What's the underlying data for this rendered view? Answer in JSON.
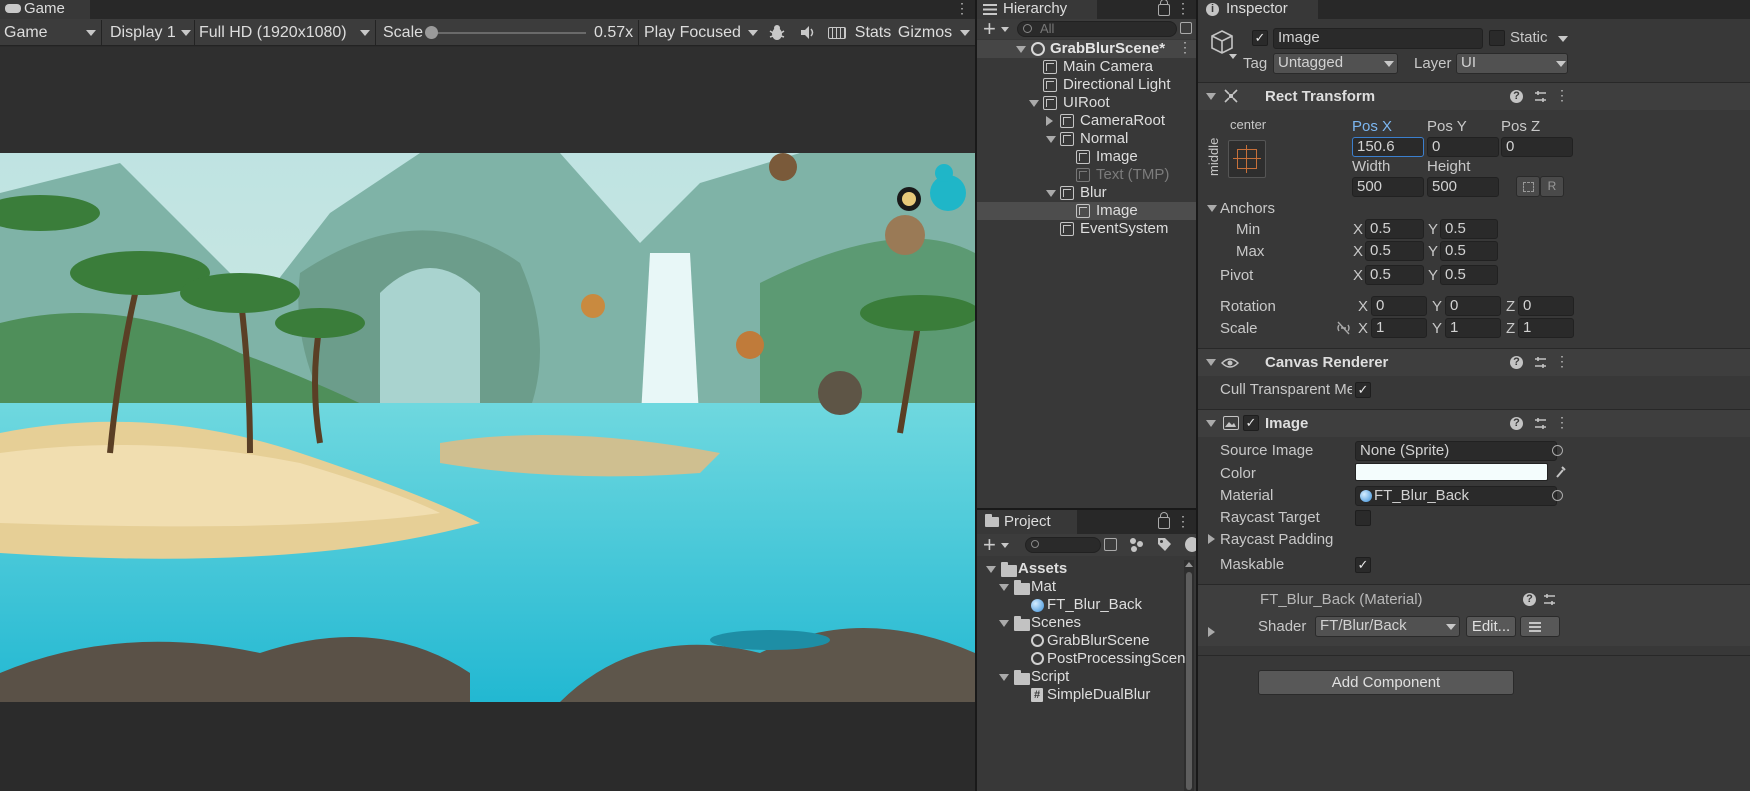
{
  "game": {
    "tab_label": "Game",
    "toolbar": {
      "mode": "Game",
      "display": "Display 1",
      "resolution": "Full HD (1920x1080)",
      "scale_label": "Scale",
      "scale_value": "0.57x",
      "play_mode": "Play Focused",
      "stats": "Stats",
      "gizmos": "Gizmos"
    }
  },
  "hierarchy": {
    "tab_label": "Hierarchy",
    "search_placeholder": "All",
    "scene_name": "GrabBlurScene*",
    "items": [
      {
        "label": "Main Camera",
        "depth": 1,
        "expand": "none",
        "dim": false,
        "selected": false
      },
      {
        "label": "Directional Light",
        "depth": 1,
        "expand": "none",
        "dim": false,
        "selected": false
      },
      {
        "label": "UIRoot",
        "depth": 1,
        "expand": "open",
        "dim": false,
        "selected": false
      },
      {
        "label": "CameraRoot",
        "depth": 2,
        "expand": "closed",
        "dim": false,
        "selected": false
      },
      {
        "label": "Normal",
        "depth": 2,
        "expand": "open",
        "dim": false,
        "selected": false
      },
      {
        "label": "Image",
        "depth": 3,
        "expand": "none",
        "dim": false,
        "selected": false
      },
      {
        "label": "Text (TMP)",
        "depth": 3,
        "expand": "none",
        "dim": true,
        "selected": false
      },
      {
        "label": "Blur",
        "depth": 2,
        "expand": "open",
        "dim": false,
        "selected": false
      },
      {
        "label": "Image",
        "depth": 3,
        "expand": "none",
        "dim": false,
        "selected": true
      },
      {
        "label": "EventSystem",
        "depth": 2,
        "expand": "none",
        "dim": false,
        "selected": false
      }
    ]
  },
  "project": {
    "tab_label": "Project",
    "items": [
      {
        "label": "Assets",
        "depth": 0,
        "kind": "folder",
        "bold": true
      },
      {
        "label": "Mat",
        "depth": 1,
        "kind": "folder",
        "bold": false
      },
      {
        "label": "FT_Blur_Back",
        "depth": 2,
        "kind": "material",
        "bold": false
      },
      {
        "label": "Scenes",
        "depth": 1,
        "kind": "folder",
        "bold": false
      },
      {
        "label": "GrabBlurScene",
        "depth": 2,
        "kind": "scene",
        "bold": false
      },
      {
        "label": "PostProcessingScen",
        "depth": 2,
        "kind": "scene",
        "bold": false
      },
      {
        "label": "Script",
        "depth": 1,
        "kind": "folder",
        "bold": false
      },
      {
        "label": "SimpleDualBlur",
        "depth": 2,
        "kind": "script",
        "bold": false
      }
    ]
  },
  "inspector": {
    "tab_label": "Inspector",
    "object_name": "Image",
    "static_label": "Static",
    "tag_label": "Tag",
    "tag_value": "Untagged",
    "layer_label": "Layer",
    "layer_value": "UI",
    "rect_transform": {
      "title": "Rect Transform",
      "anchor_h": "center",
      "anchor_v": "middle",
      "pos_x_label": "Pos X",
      "pos_y_label": "Pos Y",
      "pos_z_label": "Pos Z",
      "pos_x": "150.6",
      "pos_y": "0",
      "pos_z": "0",
      "width_label": "Width",
      "height_label": "Height",
      "width": "500",
      "height": "500",
      "anchors_label": "Anchors",
      "min_label": "Min",
      "max_label": "Max",
      "min_x": "0.5",
      "min_y": "0.5",
      "max_x": "0.5",
      "max_y": "0.5",
      "pivot_label": "Pivot",
      "pivot_x": "0.5",
      "pivot_y": "0.5",
      "rotation_label": "Rotation",
      "rot_x": "0",
      "rot_y": "0",
      "rot_z": "0",
      "scale_label": "Scale",
      "scale_x": "1",
      "scale_y": "1",
      "scale_z": "1",
      "x": "X",
      "y": "Y",
      "z": "Z",
      "r": "R"
    },
    "canvas_renderer": {
      "title": "Canvas Renderer",
      "cull_label": "Cull Transparent Me:"
    },
    "image": {
      "title": "Image",
      "source_image_label": "Source Image",
      "source_image_value": "None (Sprite)",
      "color_label": "Color",
      "material_label": "Material",
      "material_value": "FT_Blur_Back",
      "raycast_target_label": "Raycast Target",
      "raycast_padding_label": "Raycast Padding",
      "maskable_label": "Maskable"
    },
    "material": {
      "title": "FT_Blur_Back (Material)",
      "shader_label": "Shader",
      "shader_value": "FT/Blur/Back",
      "edit_label": "Edit..."
    },
    "add_component": "Add Component"
  },
  "colors": {
    "panel_bg": "#383838",
    "selection": "#4d4d4d",
    "accent": "#7cb6f0"
  }
}
